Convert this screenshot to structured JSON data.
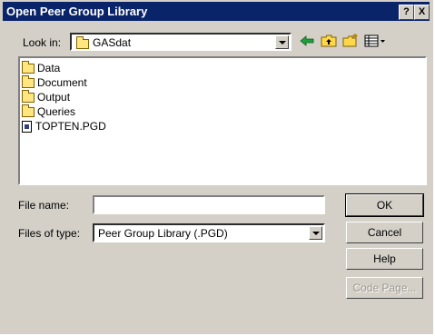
{
  "window": {
    "title": "Open Peer Group Library"
  },
  "titlebar": {
    "help": "?",
    "close": "X"
  },
  "lookin": {
    "label": "Look in:",
    "value": "GASdat"
  },
  "files": [
    {
      "name": "Data",
      "icon": "folder-icon"
    },
    {
      "name": "Document",
      "icon": "folder-icon"
    },
    {
      "name": "Output",
      "icon": "folder-icon"
    },
    {
      "name": "Queries",
      "icon": "folder-icon"
    },
    {
      "name": "TOPTEN.PGD",
      "icon": "file-icon"
    }
  ],
  "filename": {
    "label": "File name:",
    "value": ""
  },
  "filetype": {
    "label": "Files of type:",
    "value": "Peer Group Library (.PGD)"
  },
  "buttons": {
    "ok": "OK",
    "cancel": "Cancel",
    "help": "Help",
    "codepage": "Code Page..."
  }
}
